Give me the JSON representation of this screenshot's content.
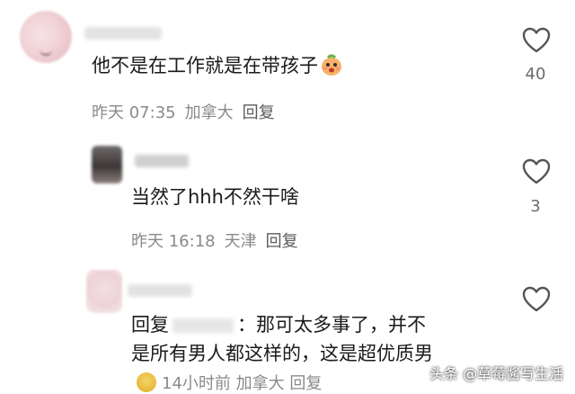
{
  "comments": [
    {
      "text": "他不是在工作就是在带孩子",
      "time": "昨天 07:35",
      "location": "加拿大",
      "reply_label": "回复",
      "likes": "40",
      "emoji": "peach-face-emoji"
    },
    {
      "text": "当然了hhh不然干啥",
      "time": "昨天 16:18",
      "location": "天津",
      "reply_label": "回复",
      "likes": "3"
    },
    {
      "text_prefix": "回复",
      "text_after": "：那可太多事了，并不",
      "text_line2": "是所有男人都这样的，这是超优质男",
      "partial_meta": "14小时前  加拿大  回复"
    }
  ],
  "watermark": "头条 @草莓酱写生活",
  "colors": {
    "text": "#1a1a1a",
    "meta": "#8a8a8a",
    "icon": "#555555"
  }
}
